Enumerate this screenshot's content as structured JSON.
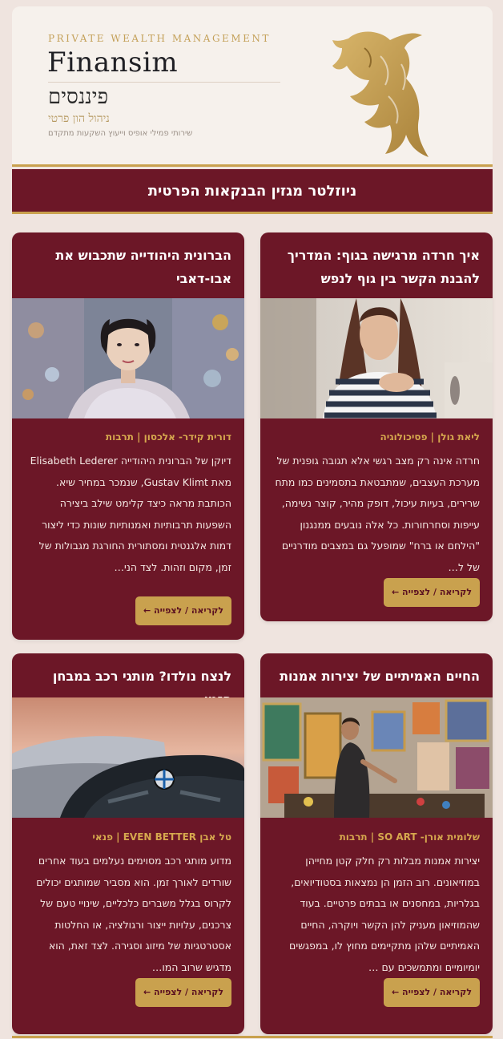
{
  "header": {
    "tagline_en": "PRIVATE WEALTH MANAGEMENT",
    "brand": "Finansim",
    "brand_he": "פיננסים",
    "subtitle_he": "ניהול הון פרטי",
    "description_he": "שירותי פמילי אופיס וייעוץ השקעות מתקדם",
    "logo_icon": "bull-logo-icon",
    "colors": {
      "gold": "#c9a14e",
      "burgundy": "#6c1727"
    }
  },
  "banner": {
    "title": "ניוזלטר מגזין הבנקאות הפרטית"
  },
  "articles": [
    {
      "title": "איך חרדה מרגישה בגוף: המדריך להבנת הקשר בין גוף לנפש",
      "meta": "ליאת גולן | פסיכולוגיה",
      "body": "חרדה אינה רק מצב רגשי אלא תגובה גופנית של מערכת העצבים, שמתבטאת בתסמינים כמו מתח שרירים, בעיות עיכול, דופק מהיר, קוצר נשימה, עייפות וסחרחורות. כל אלה נובעים ממנגנון \"הילחם או ברח\" שמופעל גם במצבים מודרניים של ל…",
      "button": "לקריאה / לצפייה ←",
      "image": "woman-anxiety-photo"
    },
    {
      "title": "הברונית היהודייה שתכבוש את אבו-דאבי",
      "meta": "דורית קידר- אלכסון | תרבות",
      "body": "דיוקן של הברונית היהודייה Elisabeth Lederer מאת Gustav Klimt, שנמכר במחיר שיא. הכותבת מראה כיצד קלימט שילב ביצירה השפעות תרבותיות ואמנותיות שונות כדי ליצור דמות אלגנטית ומסתורית החורגת מגבולות של זמן, מקום וזהות. לצד הני…",
      "button": "לקריאה / לצפייה ←",
      "image": "klimt-portrait-painting"
    },
    {
      "title": "החיים האמיתיים של יצירות אמנות",
      "meta": "שלומית אורן- SO ART | תרבות",
      "body": "יצירות אמנות מבלות רק חלק קטן מחייהן במוזיאונים. רוב הזמן הן נמצאות בסטודיואים, בגלריות, במחסנים או בבתים פרטיים. בעוד שהמוזיאון מעניק להן הקשר ויוקרה, החיים האמיתיים שלהן מתקיימים מחוץ לו, במפגשים יומיומיים ומתמשכים עם …",
      "button": "לקריאה / לצפייה ←",
      "image": "artist-studio-photo"
    },
    {
      "title": "לנצח נולדו? מותגי רכב במבחן הזמן",
      "meta": "טל אבן EVEN BETTER | פנאי",
      "body": "מדוע מותגי רכב מסוימים נעלמים בעוד אחרים שורדים לאורך זמן. הוא מסביר שמותגים יכולים לקרוס בגלל משברים כלכליים, שינויי טעם של צרכנים, עלויות ייצור ורגולציה, או החלטות אסטרטגיות של מיזוג וסגירה. לצד זאת, הוא מדגיש שרוב המו…",
      "button": "לקריאה / לצפייה ←",
      "image": "bmw-car-photo"
    }
  ]
}
